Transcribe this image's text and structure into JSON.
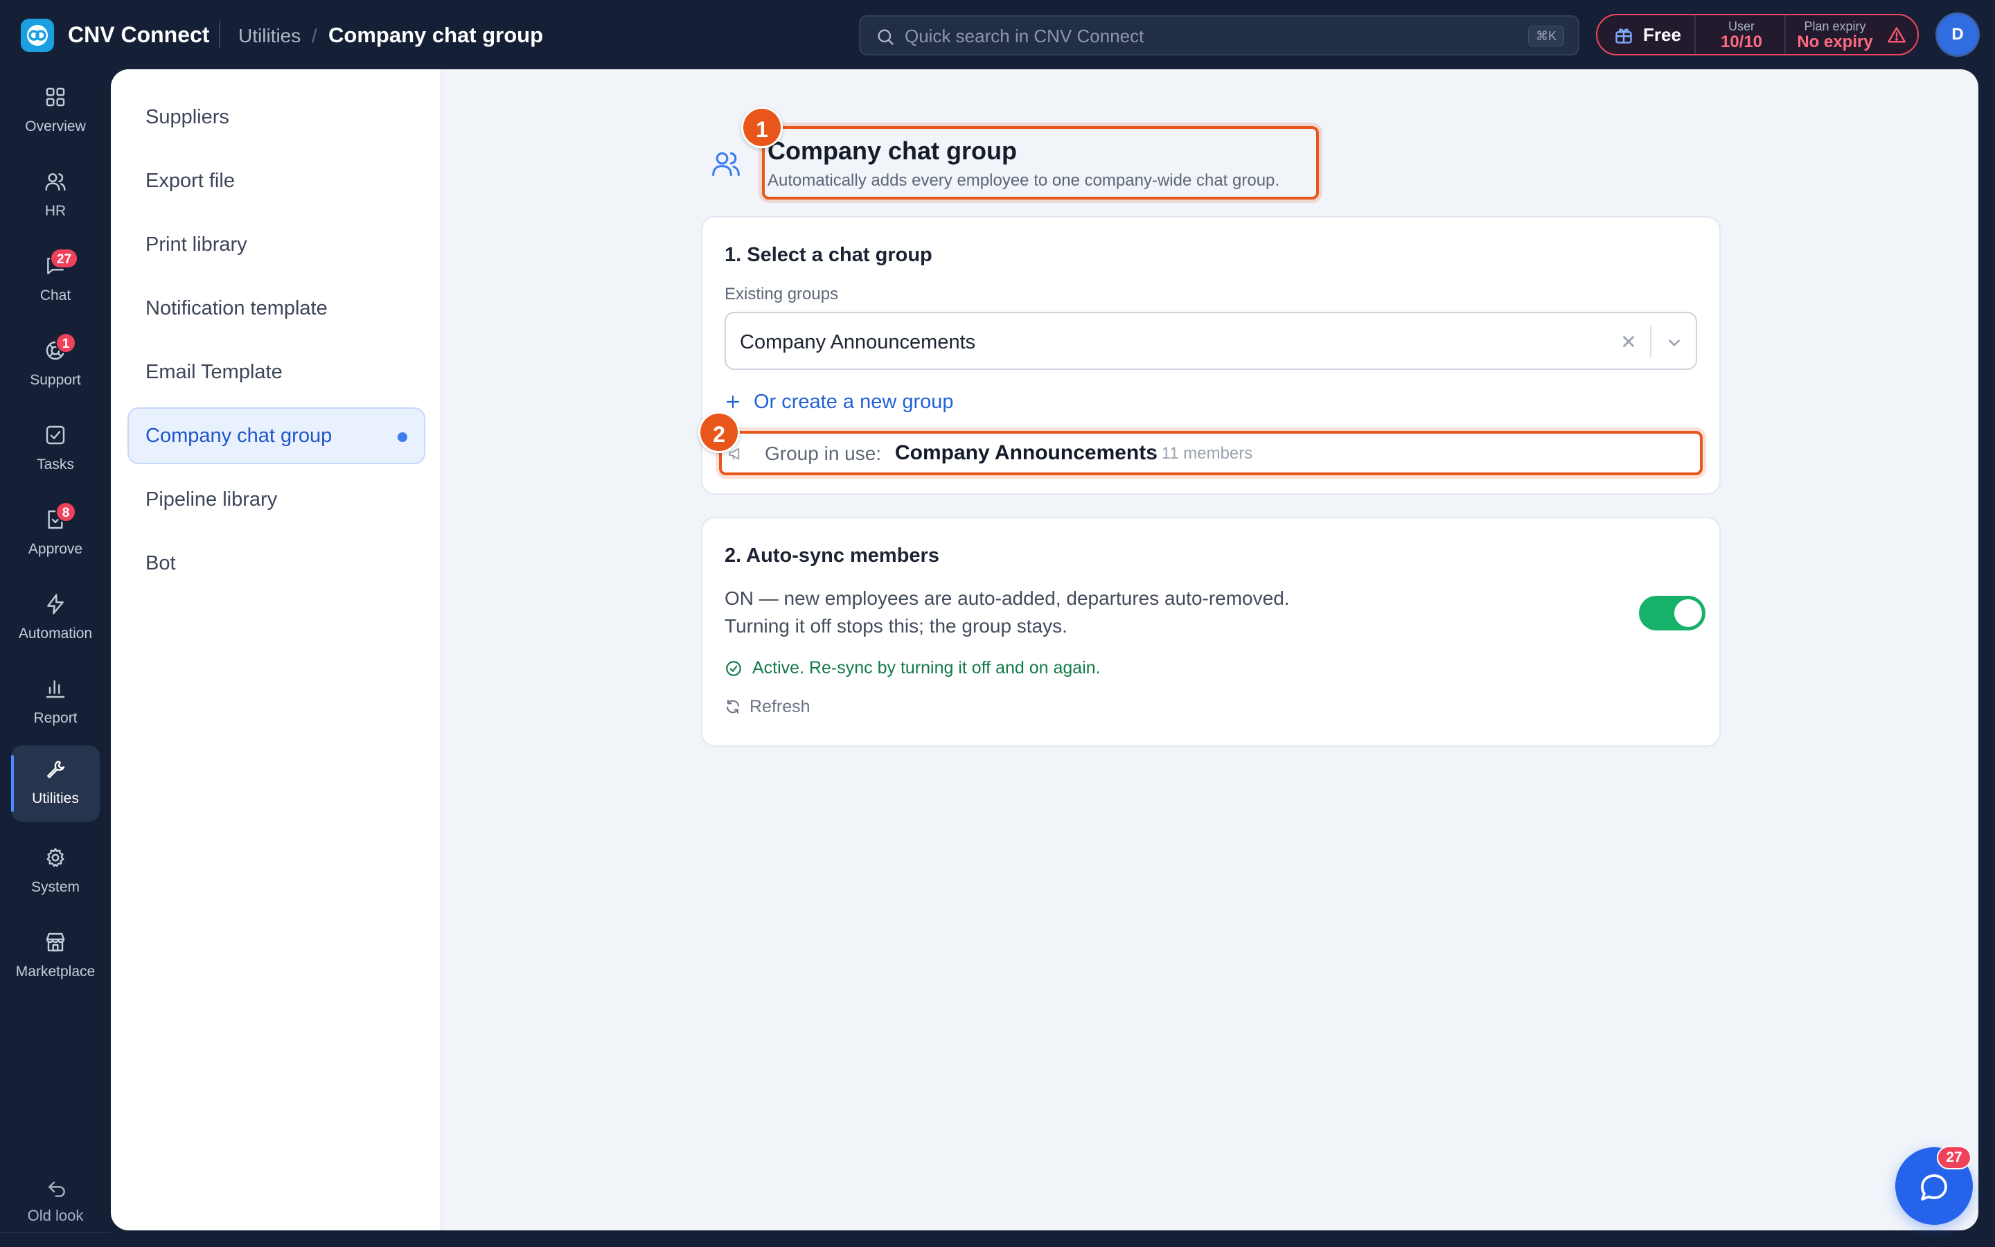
{
  "app": {
    "title": "CNV Connect",
    "breadcrumb": [
      "Utilities",
      "/",
      "Company chat group"
    ]
  },
  "search": {
    "placeholder": "Quick search in CNV Connect",
    "shortcut": "⌘K"
  },
  "plan": {
    "name": "Free",
    "user_label": "User",
    "user_value": "10/10",
    "expiry_label": "Plan expiry",
    "expiry_value": "No expiry"
  },
  "user": {
    "avatar_initial": "D"
  },
  "rail": {
    "items": [
      {
        "label": "Overview",
        "icon": "grid-icon"
      },
      {
        "label": "HR",
        "icon": "users-icon"
      },
      {
        "label": "Chat",
        "icon": "chat-icon",
        "badge": "27"
      },
      {
        "label": "Support",
        "icon": "lifebuoy-icon",
        "badge": "1"
      },
      {
        "label": "Tasks",
        "icon": "checkbox-icon"
      },
      {
        "label": "Approve",
        "icon": "approve-icon",
        "badge": "8"
      },
      {
        "label": "Automation",
        "icon": "bolt-icon"
      },
      {
        "label": "Report",
        "icon": "bar-chart-icon"
      },
      {
        "label": "Utilities",
        "icon": "wrench-icon",
        "active": true
      },
      {
        "label": "System",
        "icon": "gear-icon"
      },
      {
        "label": "Marketplace",
        "icon": "store-icon"
      }
    ],
    "old_look": "Old look"
  },
  "subnav": {
    "items": [
      "Suppliers",
      "Export file",
      "Print library",
      "Notification template",
      "Email Template",
      "Company chat group",
      "Pipeline library",
      "Bot"
    ],
    "active": "Company chat group"
  },
  "page": {
    "title": "Company chat group",
    "subtitle": "Automatically adds every employee to one company-wide chat group.",
    "step_badges": [
      "1",
      "2"
    ]
  },
  "select_group": {
    "title": "1. Select a chat group",
    "field_label": "Existing groups",
    "selected_value": "Company Announcements",
    "create_link": "Or create a new group",
    "in_use_label": "Group in use:",
    "in_use_name": "Company Announcements",
    "in_use_members": "· 11 members"
  },
  "auto_sync": {
    "title": "2. Auto-sync members",
    "description_line1": "ON — new employees are auto-added, departures auto-removed.",
    "description_line2": "Turning it off stops this; the group stays.",
    "toggle_on": true,
    "status": "Active. Re-sync by turning it off and on again.",
    "refresh_label": "Refresh"
  },
  "chat_fab": {
    "badge": "27"
  },
  "colors": {
    "shell": "#152036",
    "accent": "#2563eb",
    "highlight": "#e8561b",
    "success": "#17b26a",
    "danger": "#f0415b"
  }
}
